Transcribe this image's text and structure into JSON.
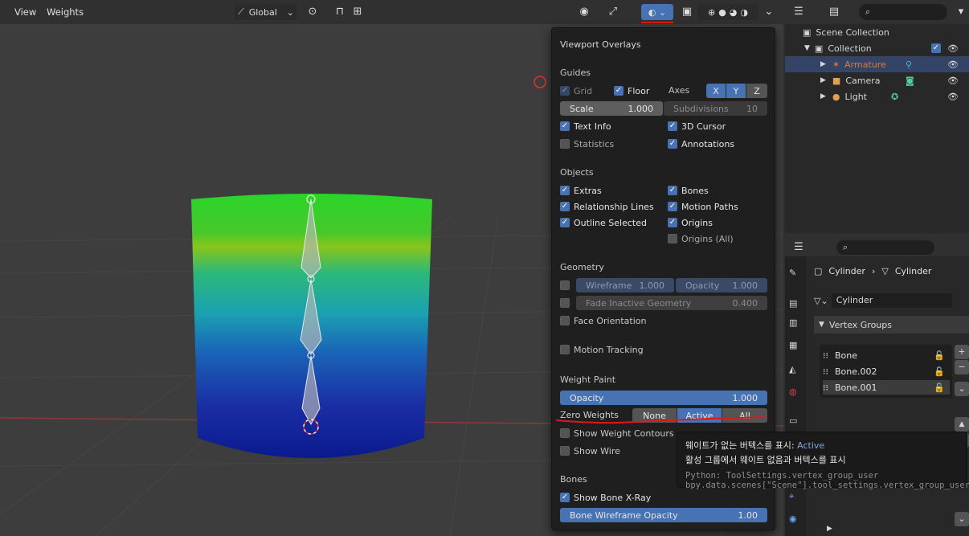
{
  "header": {
    "menu_view": "View",
    "menu_weights": "Weights",
    "orientation": "Global"
  },
  "overlay": {
    "title": "Viewport Overlays",
    "guides": {
      "heading": "Guides",
      "grid": "Grid",
      "floor": "Floor",
      "axes": "Axes",
      "axis_x": "X",
      "axis_y": "Y",
      "axis_z": "Z",
      "scale_label": "Scale",
      "scale_value": "1.000",
      "subdiv_label": "Subdivisions",
      "subdiv_value": "10",
      "text_info": "Text Info",
      "cursor": "3D Cursor",
      "statistics": "Statistics",
      "annotations": "Annotations"
    },
    "objects": {
      "heading": "Objects",
      "extras": "Extras",
      "bones": "Bones",
      "rel_lines": "Relationship Lines",
      "motion_paths": "Motion Paths",
      "outline_selected": "Outline Selected",
      "origins": "Origins",
      "origins_all": "Origins (All)"
    },
    "geometry": {
      "heading": "Geometry",
      "wireframe_label": "Wireframe",
      "wireframe_value": "1.000",
      "opacity_label": "Opacity",
      "opacity_value": "1.000",
      "fade_label": "Fade Inactive Geometry",
      "fade_value": "0.400",
      "face_orientation": "Face Orientation",
      "motion_tracking": "Motion Tracking"
    },
    "weight_paint": {
      "heading": "Weight Paint",
      "opacity_label": "Opacity",
      "opacity_value": "1.000",
      "zero_weights": "Zero Weights",
      "opt_none": "None",
      "opt_active": "Active",
      "opt_all": "All",
      "show_contours": "Show Weight Contours",
      "show_wire": "Show Wire"
    },
    "bones": {
      "heading": "Bones",
      "xray": "Show Bone X-Ray",
      "wire_opacity_label": "Bone Wireframe Opacity",
      "wire_opacity_value": "1.00"
    }
  },
  "outliner": {
    "scene_collection": "Scene Collection",
    "collection": "Collection",
    "armature": "Armature",
    "camera": "Camera",
    "light": "Light"
  },
  "properties": {
    "breadcrumb_obj": "Cylinder",
    "breadcrumb_mesh": "Cylinder",
    "mesh_name": "Cylinder",
    "vertex_groups_heading": "Vertex Groups",
    "groups": [
      "Bone",
      "Bone.002",
      "Bone.001"
    ]
  },
  "tooltip": {
    "line1_prefix": "웨이트가 없는 버텍스를 표시: ",
    "line1_value": "Active",
    "line2": "활성 그룹에서 웨이트 없음과 버텍스를 표시",
    "line3": "Python: ToolSettings.vertex_group_user",
    "line4": "bpy.data.scenes[\"Scene\"].tool_settings.vertex_group_user"
  },
  "colors": {
    "accent": "#4772b3",
    "highlight_text": "#e07a30",
    "annotation_red": "#e01818"
  }
}
